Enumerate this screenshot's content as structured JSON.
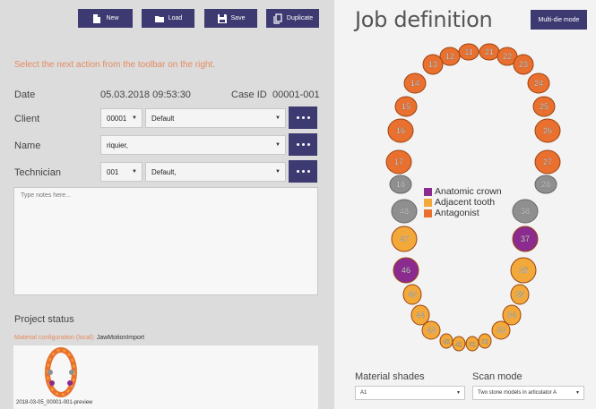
{
  "toolbar": {
    "new_label": "New",
    "load_label": "Load",
    "save_label": "Save",
    "duplicate_label": "Duplicate"
  },
  "hint": "Select the next action from the toolbar on the right.",
  "form": {
    "date_label": "Date",
    "date_value": "05.03.2018  09:53:30",
    "case_id_label": "Case ID",
    "case_id_value": "00001-001",
    "client_label": "Client",
    "client_code": "00001",
    "client_name": "Default",
    "name_label": "Name",
    "name_value": "riquier,",
    "technician_label": "Technician",
    "technician_code": "001",
    "technician_name": "Default,"
  },
  "notes": {
    "placeholder": "Type notes here..."
  },
  "project_status": {
    "title": "Project status",
    "config_label": "Material configuration (local):",
    "config_value": "JawMotionImport",
    "preview_caption": "2018-03-05_00001-001-preview"
  },
  "job": {
    "title": "Job definition",
    "multi_die_label": "Multi-die mode"
  },
  "legend": [
    {
      "label": "Anatomic crown",
      "color": "#8b2a8f"
    },
    {
      "label": "Adjacent tooth",
      "color": "#f2a93a"
    },
    {
      "label": "Antagonist",
      "color": "#e9702e"
    }
  ],
  "teeth": {
    "upper": [
      "11",
      "12",
      "13",
      "14",
      "15",
      "16",
      "17",
      "18",
      "21",
      "22",
      "23",
      "24",
      "25",
      "26",
      "27",
      "28"
    ],
    "lower": [
      "31",
      "32",
      "33",
      "34",
      "35",
      "36",
      "37",
      "38",
      "41",
      "42",
      "43",
      "44",
      "45",
      "46",
      "47",
      "48"
    ]
  },
  "material_shades": {
    "label": "Material shades",
    "value": "A1"
  },
  "scan_mode": {
    "label": "Scan mode",
    "value": "Two stone models in articulator A"
  },
  "colors": {
    "accent": "#3d3a72",
    "antagonist": "#e9702e",
    "adjacent": "#f2a93a",
    "crown": "#8b2a8f",
    "none": "#8f8f8f"
  }
}
